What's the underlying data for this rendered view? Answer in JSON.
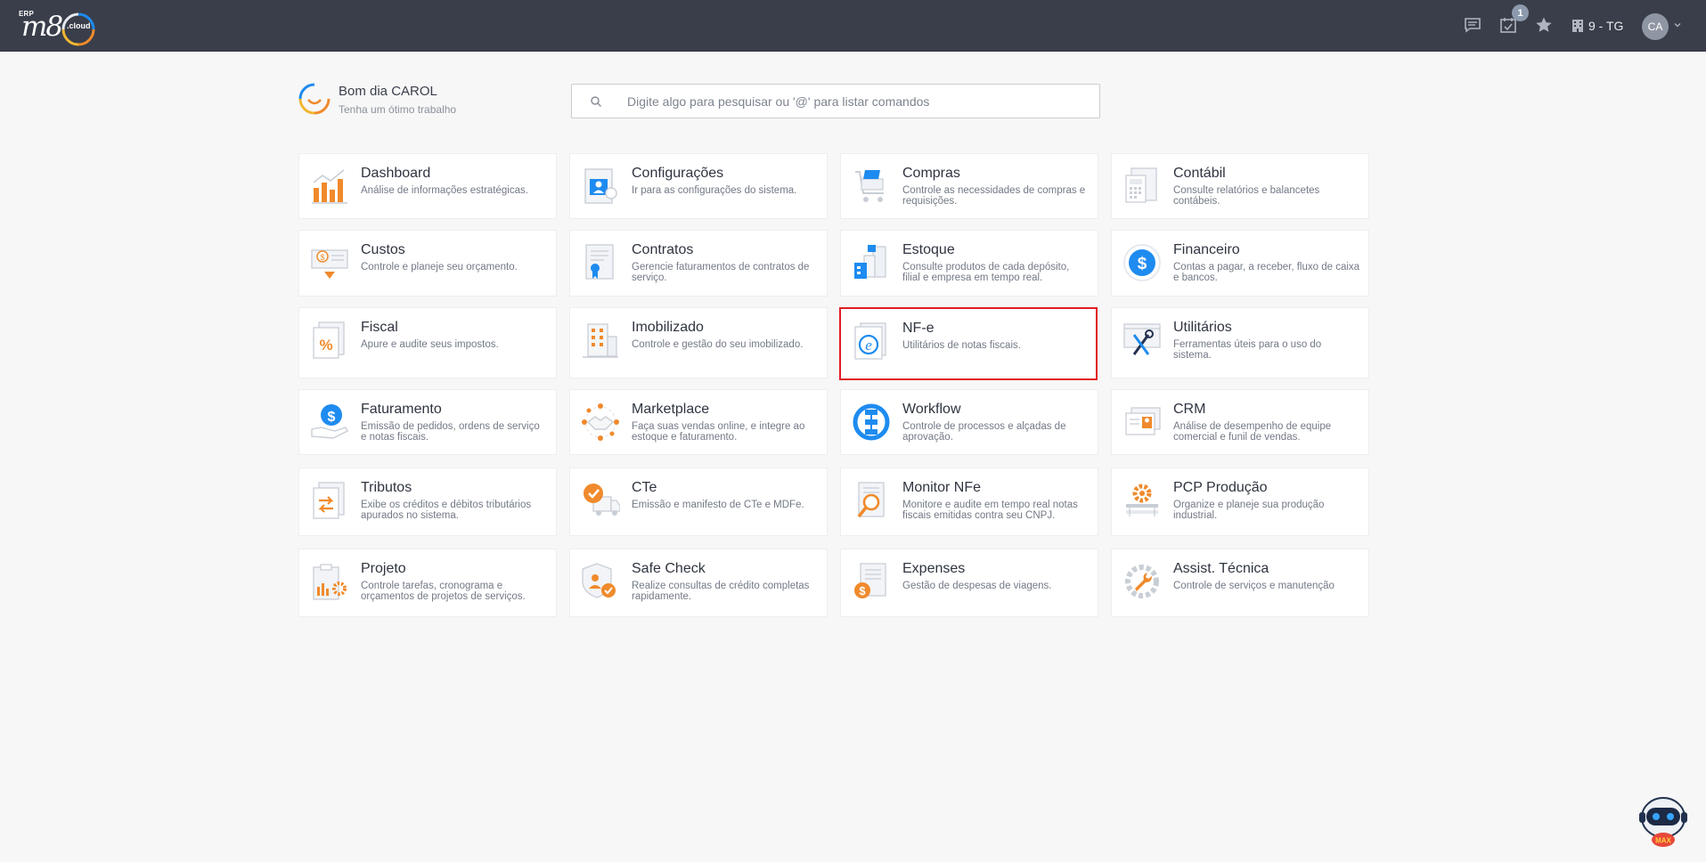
{
  "header": {
    "logo_erp": "ERP",
    "logo_mark": "m8",
    "logo_cloud": ".cloud",
    "notifications_count": "1",
    "company": "9 - TG",
    "user_initials": "CA"
  },
  "greeting": {
    "title": "Bom dia CAROL",
    "subtitle": "Tenha um ótimo trabalho"
  },
  "search": {
    "placeholder": "Digite algo para pesquisar ou '@' para listar comandos"
  },
  "modules": [
    {
      "title": "Dashboard",
      "desc": "Análise de informações estratégicas.",
      "icon": "dashboard-chart-icon"
    },
    {
      "title": "Configurações",
      "desc": "Ir para as configurações do sistema.",
      "icon": "settings-profile-icon"
    },
    {
      "title": "Compras",
      "desc": "Controle as necessidades de compras e requisições.",
      "icon": "shopping-cart-icon"
    },
    {
      "title": "Contábil",
      "desc": "Consulte relatórios e balancetes contábeis.",
      "icon": "calculator-document-icon"
    },
    {
      "title": "Custos",
      "desc": "Controle e planeje seu orçamento.",
      "icon": "cost-money-icon"
    },
    {
      "title": "Contratos",
      "desc": "Gerencie faturamentos de contratos de serviço.",
      "icon": "contract-document-icon"
    },
    {
      "title": "Estoque",
      "desc": "Consulte produtos de cada depósito, filial e empresa em tempo real.",
      "icon": "warehouse-buildings-icon"
    },
    {
      "title": "Financeiro",
      "desc": "Contas a pagar, a receber, fluxo de caixa e bancos.",
      "icon": "dollar-coin-icon"
    },
    {
      "title": "Fiscal",
      "desc": "Apure e audite seus impostos.",
      "icon": "percent-document-icon"
    },
    {
      "title": "Imobilizado",
      "desc": "Controle e gestão do seu imobilizado.",
      "icon": "building-icon"
    },
    {
      "title": "NF-e",
      "desc": "Utilitários de notas fiscais.",
      "icon": "nfe-document-icon"
    },
    {
      "title": "Utilitários",
      "desc": "Ferramentas úteis para o uso do sistema.",
      "icon": "tools-icon"
    },
    {
      "title": "Faturamento",
      "desc": "Emissão de pedidos, ordens de serviço e notas fiscais.",
      "icon": "billing-hand-icon"
    },
    {
      "title": "Marketplace",
      "desc": "Faça suas vendas online, e integre ao estoque e faturamento.",
      "icon": "handshake-icon"
    },
    {
      "title": "Workflow",
      "desc": "Controle de processos e alçadas de aprovação.",
      "icon": "workflow-icon"
    },
    {
      "title": "CRM",
      "desc": "Análise de desempenho de equipe comercial e funil de vendas.",
      "icon": "crm-contact-icon"
    },
    {
      "title": "Tributos",
      "desc": "Exibe os créditos e débitos tributários apurados no sistema.",
      "icon": "tax-arrows-icon"
    },
    {
      "title": "CTe",
      "desc": "Emissão e manifesto de CTe e MDFe.",
      "icon": "truck-check-icon"
    },
    {
      "title": "Monitor NFe",
      "desc": "Monitore e audite em tempo real notas fiscais emitidas contra seu CNPJ.",
      "icon": "magnifier-document-icon"
    },
    {
      "title": "PCP Produção",
      "desc": "Organize e planeje sua produção industrial.",
      "icon": "production-gear-icon"
    },
    {
      "title": "Projeto",
      "desc": "Controle tarefas, cronograma e orçamentos de projetos de serviços.",
      "icon": "project-clipboard-icon"
    },
    {
      "title": "Safe Check",
      "desc": "Realize consultas de crédito completas rapidamente.",
      "icon": "shield-check-icon"
    },
    {
      "title": "Expenses",
      "desc": "Gestão de despesas de viagens.",
      "icon": "expenses-receipt-icon"
    },
    {
      "title": "Assist. Técnica",
      "desc": "Controle de serviços e manutenção",
      "icon": "wrench-gear-icon"
    }
  ],
  "assistant": {
    "label": "MAX"
  },
  "colors": {
    "topbar": "#393e4a",
    "accent_orange": "#f08a2c",
    "accent_blue": "#1e8bf0",
    "selected_border": "#e11b22"
  }
}
